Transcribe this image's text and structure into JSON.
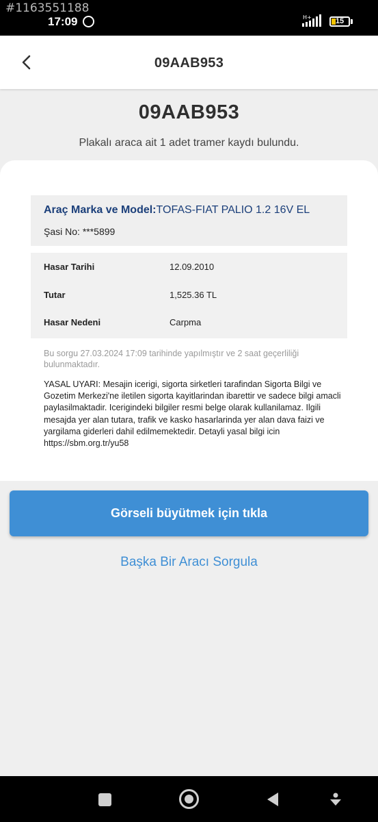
{
  "status_bar": {
    "id_text": "#1163551188",
    "time": "17:09",
    "network": "H+",
    "battery": "15"
  },
  "app_bar": {
    "title": "09AAB953",
    "back_icon": "chevron-left-icon"
  },
  "header": {
    "plate": "09AAB953",
    "result_text": "Plakalı araca ait 1 adet tramer kaydı bulundu."
  },
  "vehicle": {
    "model_label": "Araç Marka ve Model:",
    "model_value": "TOFAS-FIAT PALIO 1.2 16V EL",
    "chassis_label": "Şasi No: ",
    "chassis_value": "***5899"
  },
  "damage": {
    "rows": [
      {
        "key": "Hasar Tarihi",
        "value": "12.09.2010"
      },
      {
        "key": "Tutar",
        "value": "1,525.36 TL"
      },
      {
        "key": "Hasar Nedeni",
        "value": "Carpma"
      }
    ]
  },
  "query_note": "Bu sorgu 27.03.2024 17:09 tarihinde yapılmıştır ve 2 saat geçerliliği bulunmaktadır.",
  "legal_text": "YASAL UYARI: Mesajin icerigi, sigorta sirketleri tarafindan Sigorta Bilgi ve Gozetim Merkezi'ne iletilen sigorta kayitlarindan ibarettir ve sadece bilgi amacli paylasilmaktadir. Icerigindeki bilgiler resmi belge olarak kullanilamaz. Ilgili mesajda yer alan tutara, trafik ve kasko hasarlarinda yer alan dava faizi ve yargilama giderleri dahil edilmemektedir. Detayli yasal bilgi icin https://sbm.org.tr/yu58",
  "actions": {
    "primary_label": "Görseli büyütmek için tıkla",
    "secondary_label": "Başka Bir Aracı Sorgula"
  },
  "nav_bar": {
    "icons": [
      "square-recents-icon",
      "circle-home-icon",
      "triangle-back-icon",
      "assistant-icon"
    ]
  },
  "colors": {
    "accent": "#3f8fd5",
    "vehicle_text": "#1b3f7a",
    "battery_fill": "#f5c400"
  }
}
